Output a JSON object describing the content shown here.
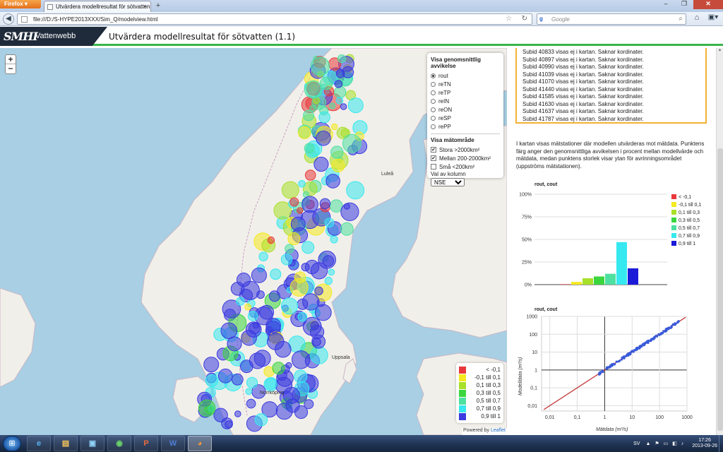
{
  "browser": {
    "menu_label": "Firefox",
    "tab_title": "Utvärdera modellresultat för sötvatten",
    "url": "file:///D:/S-HYPE2013XXX/Sim_Q/modelview.html",
    "search_placeholder": "Google"
  },
  "app": {
    "logo_text": "SMHI",
    "logo_sub": "Vattenwebb",
    "title": "Utvärdera modellresultat för sötvatten (1.1)"
  },
  "controls": {
    "deviation_header": "Visa genomsnittlig avvikelse",
    "variables": [
      "rout",
      "reTN",
      "reTP",
      "reIN",
      "reON",
      "reSP",
      "rePP"
    ],
    "selected_variable": "rout",
    "area_header": "Visa mätområde",
    "areas": [
      {
        "label": "Stora >2000km²",
        "checked": true
      },
      {
        "label": "Mellan 200-2000km²",
        "checked": true
      },
      {
        "label": "Små <200km²",
        "checked": false
      }
    ],
    "column_label": "Val av kolumn",
    "column_value": "NSE"
  },
  "legend": {
    "items": [
      {
        "label": "< -0,1",
        "color": "#e8383b"
      },
      {
        "label": "-0,1 till 0,1",
        "color": "#f4ea1f"
      },
      {
        "label": "0,1 till 0,3",
        "color": "#a8e02a"
      },
      {
        "label": "0,3 till 0,5",
        "color": "#3bd63e"
      },
      {
        "label": "0,5 till 0,7",
        "color": "#4ee0a0"
      },
      {
        "label": "0,7 till 0,9",
        "color": "#36e8ef"
      },
      {
        "label": "0,9 till 1",
        "color": "#3a3ae0"
      }
    ]
  },
  "attribution": {
    "prefix": "Powered by",
    "link": "Leaflet"
  },
  "messages": [
    "Subid 40833 visas ej i kartan. Saknar kordinater.",
    "Subid 40897 visas ej i kartan. Saknar kordinater.",
    "Subid 40990 visas ej i kartan. Saknar kordinater.",
    "Subid 41039 visas ej i kartan. Saknar kordinater.",
    "Subid 41070 visas ej i kartan. Saknar kordinater.",
    "Subid 41440 visas ej i kartan. Saknar kordinater.",
    "Subid 41585 visas ej i kartan. Saknar kordinater.",
    "Subid 41630 visas ej i kartan. Saknar kordinater.",
    "Subid 41637 visas ej i kartan. Saknar kordinater.",
    "Subid 41787 visas ej i kartan. Saknar kordinater."
  ],
  "description": "I kartan visas mätstationer där modellen utvärderas mot mätdata. Punktens färg anger den genomsnittliga avvikelsen i procent mellan modellvärde och mätdata, medan punktens storlek visar ytan för avrinningsområdet (uppströms mätstationen).",
  "map_labels": [
    "Uppsala",
    "Norrköping",
    "Luleå"
  ],
  "chart_data": [
    {
      "type": "bar",
      "title": "rout, cout",
      "categories": [
        "< -0,1",
        "-0,1 till 0,1",
        "0,1 till 0,3",
        "0,3 till 0,5",
        "0,5 till 0,7",
        "0,7 till 0,9",
        "0,9 till 1"
      ],
      "values": [
        0.5,
        3,
        7,
        9,
        12,
        47,
        18
      ],
      "colors": [
        "#e8383b",
        "#f4ea1f",
        "#a8e02a",
        "#3bd63e",
        "#4ee0a0",
        "#36e8ef",
        "#1a1ad8"
      ],
      "yticks": [
        "0%",
        "25%",
        "50%",
        "75%",
        "100%"
      ],
      "ylim": [
        0,
        100
      ]
    },
    {
      "type": "scatter",
      "title": "rout, cout",
      "xlabel": "Mätdata (m³/s)",
      "ylabel": "Modelldata (m³/s)",
      "xticks": [
        "0,01",
        "0,1",
        "1",
        "10",
        "100",
        "1000"
      ],
      "yticks": [
        "0,01",
        "0,1",
        "1",
        "10",
        "100",
        "1000"
      ],
      "xlim": [
        0.005,
        1000
      ],
      "ylim": [
        0.005,
        1000
      ],
      "log_scale": true,
      "points_color": "#3a5ad8",
      "line_color": "#c0282c"
    }
  ],
  "taskbar": {
    "apps": [
      "IE",
      "Explorer",
      "Network",
      "Chrome",
      "PowerPoint",
      "Word",
      "Firefox"
    ],
    "language": "SV",
    "time": "17:26",
    "date": "2013-09-26"
  }
}
